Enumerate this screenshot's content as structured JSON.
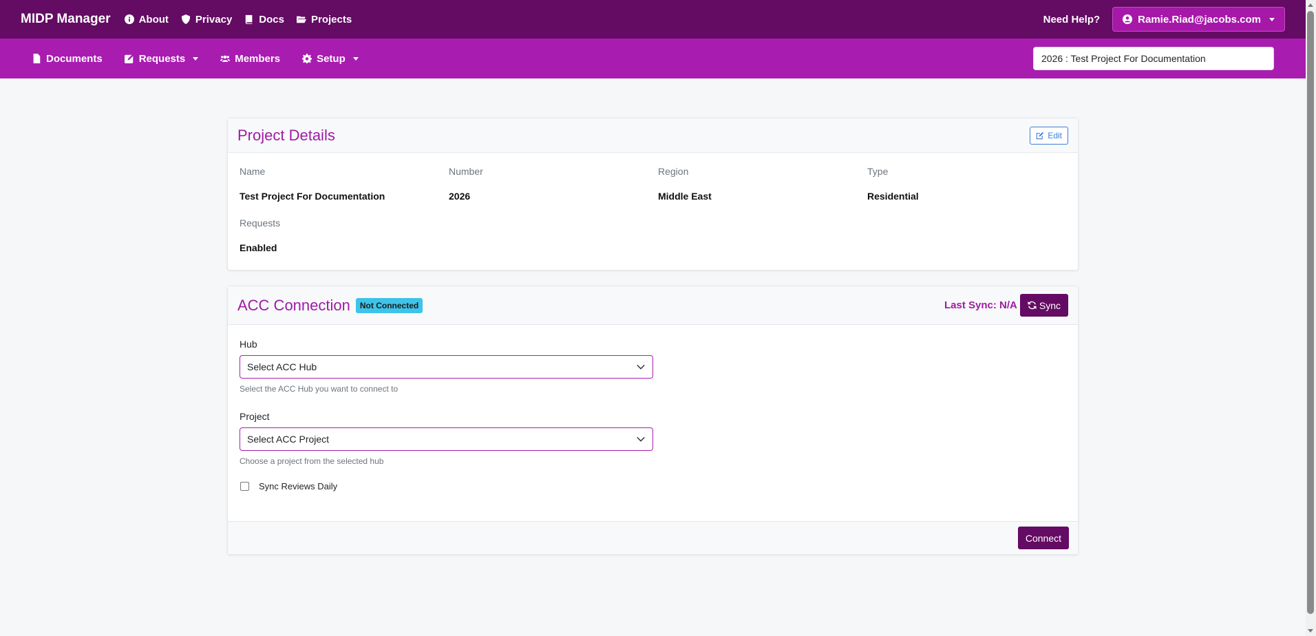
{
  "header": {
    "brand": "MIDP Manager",
    "nav": [
      {
        "label": "About",
        "icon": "info-circle-icon"
      },
      {
        "label": "Privacy",
        "icon": "shield-icon"
      },
      {
        "label": "Docs",
        "icon": "book-icon"
      },
      {
        "label": "Projects",
        "icon": "folder-open-icon"
      }
    ],
    "need_help": "Need Help?",
    "user": "Ramie.Riad@jacobs.com"
  },
  "subnav": {
    "items": [
      {
        "label": "Documents",
        "icon": "file-icon"
      },
      {
        "label": "Requests",
        "icon": "edit-square-icon",
        "dropdown": true
      },
      {
        "label": "Members",
        "icon": "users-icon"
      },
      {
        "label": "Setup",
        "icon": "gear-icon",
        "dropdown": true
      }
    ],
    "project_selector": "2026 : Test Project For Documentation"
  },
  "project_details": {
    "title": "Project Details",
    "edit_label": "Edit",
    "fields": [
      {
        "label": "Name",
        "value": "Test Project For Documentation"
      },
      {
        "label": "Number",
        "value": "2026"
      },
      {
        "label": "Region",
        "value": "Middle East"
      },
      {
        "label": "Type",
        "value": "Residential"
      },
      {
        "label": "Requests",
        "value": "Enabled"
      }
    ]
  },
  "acc": {
    "title": "ACC Connection",
    "status_badge": "Not Connected",
    "last_sync": "Last Sync: N/A",
    "sync_label": "Sync",
    "hub": {
      "label": "Hub",
      "selected": "Select ACC Hub",
      "help": "Select the ACC Hub you want to connect to"
    },
    "project": {
      "label": "Project",
      "selected": "Select ACC Project",
      "help": "Choose a project from the selected hub"
    },
    "sync_daily_label": "Sync Reviews Daily",
    "sync_daily_checked": false,
    "connect_label": "Connect"
  },
  "colors": {
    "primary_dark": "#640b63",
    "primary": "#a91cb0",
    "title_accent": "#a01aa6",
    "badge": "#3ec3ea",
    "edit_blue": "#3b7dd8"
  }
}
